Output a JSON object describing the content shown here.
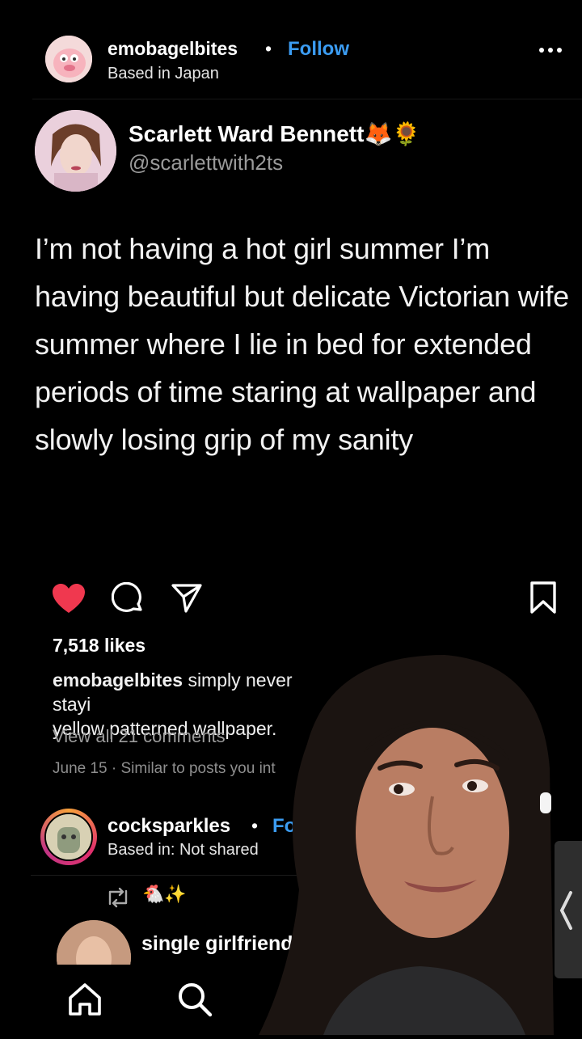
{
  "header": {
    "username": "emobagelbites",
    "dot": "•",
    "follow_label": "Follow",
    "location": "Based in Japan"
  },
  "tweet": {
    "display_name": "Scarlett Ward Bennett",
    "name_emoji": "🦊🌻",
    "handle": "@scarlettwith2ts",
    "text": "I’m not having a hot girl summer I’m having beautiful but delicate Victorian wife summer where I lie in bed for extended periods of time staring at wallpaper and slowly losing grip of my sanity"
  },
  "actions": {
    "likes": "7,518 likes",
    "caption_user": "emobagelbites",
    "caption_text": "simply never stayi",
    "caption_text_2": "yellow patterned wallpaper.",
    "view_comments": "View all 21 comments",
    "date_line": "June 15 · Similar to posts you int"
  },
  "next_post": {
    "username": "cocksparkles",
    "dot": "•",
    "follow_label": "Follo",
    "location": "Based in: Not shared",
    "emoji": "🐔✨",
    "third_name": "single girlfriend"
  },
  "colors": {
    "accent": "#3b9cf2",
    "like": "#f0384f",
    "background": "#000000"
  },
  "icons": [
    "more-icon",
    "heart-icon",
    "comment-icon",
    "share-icon",
    "save-icon",
    "retweet-icon",
    "home-icon",
    "search-icon",
    "chevron-left-icon"
  ]
}
